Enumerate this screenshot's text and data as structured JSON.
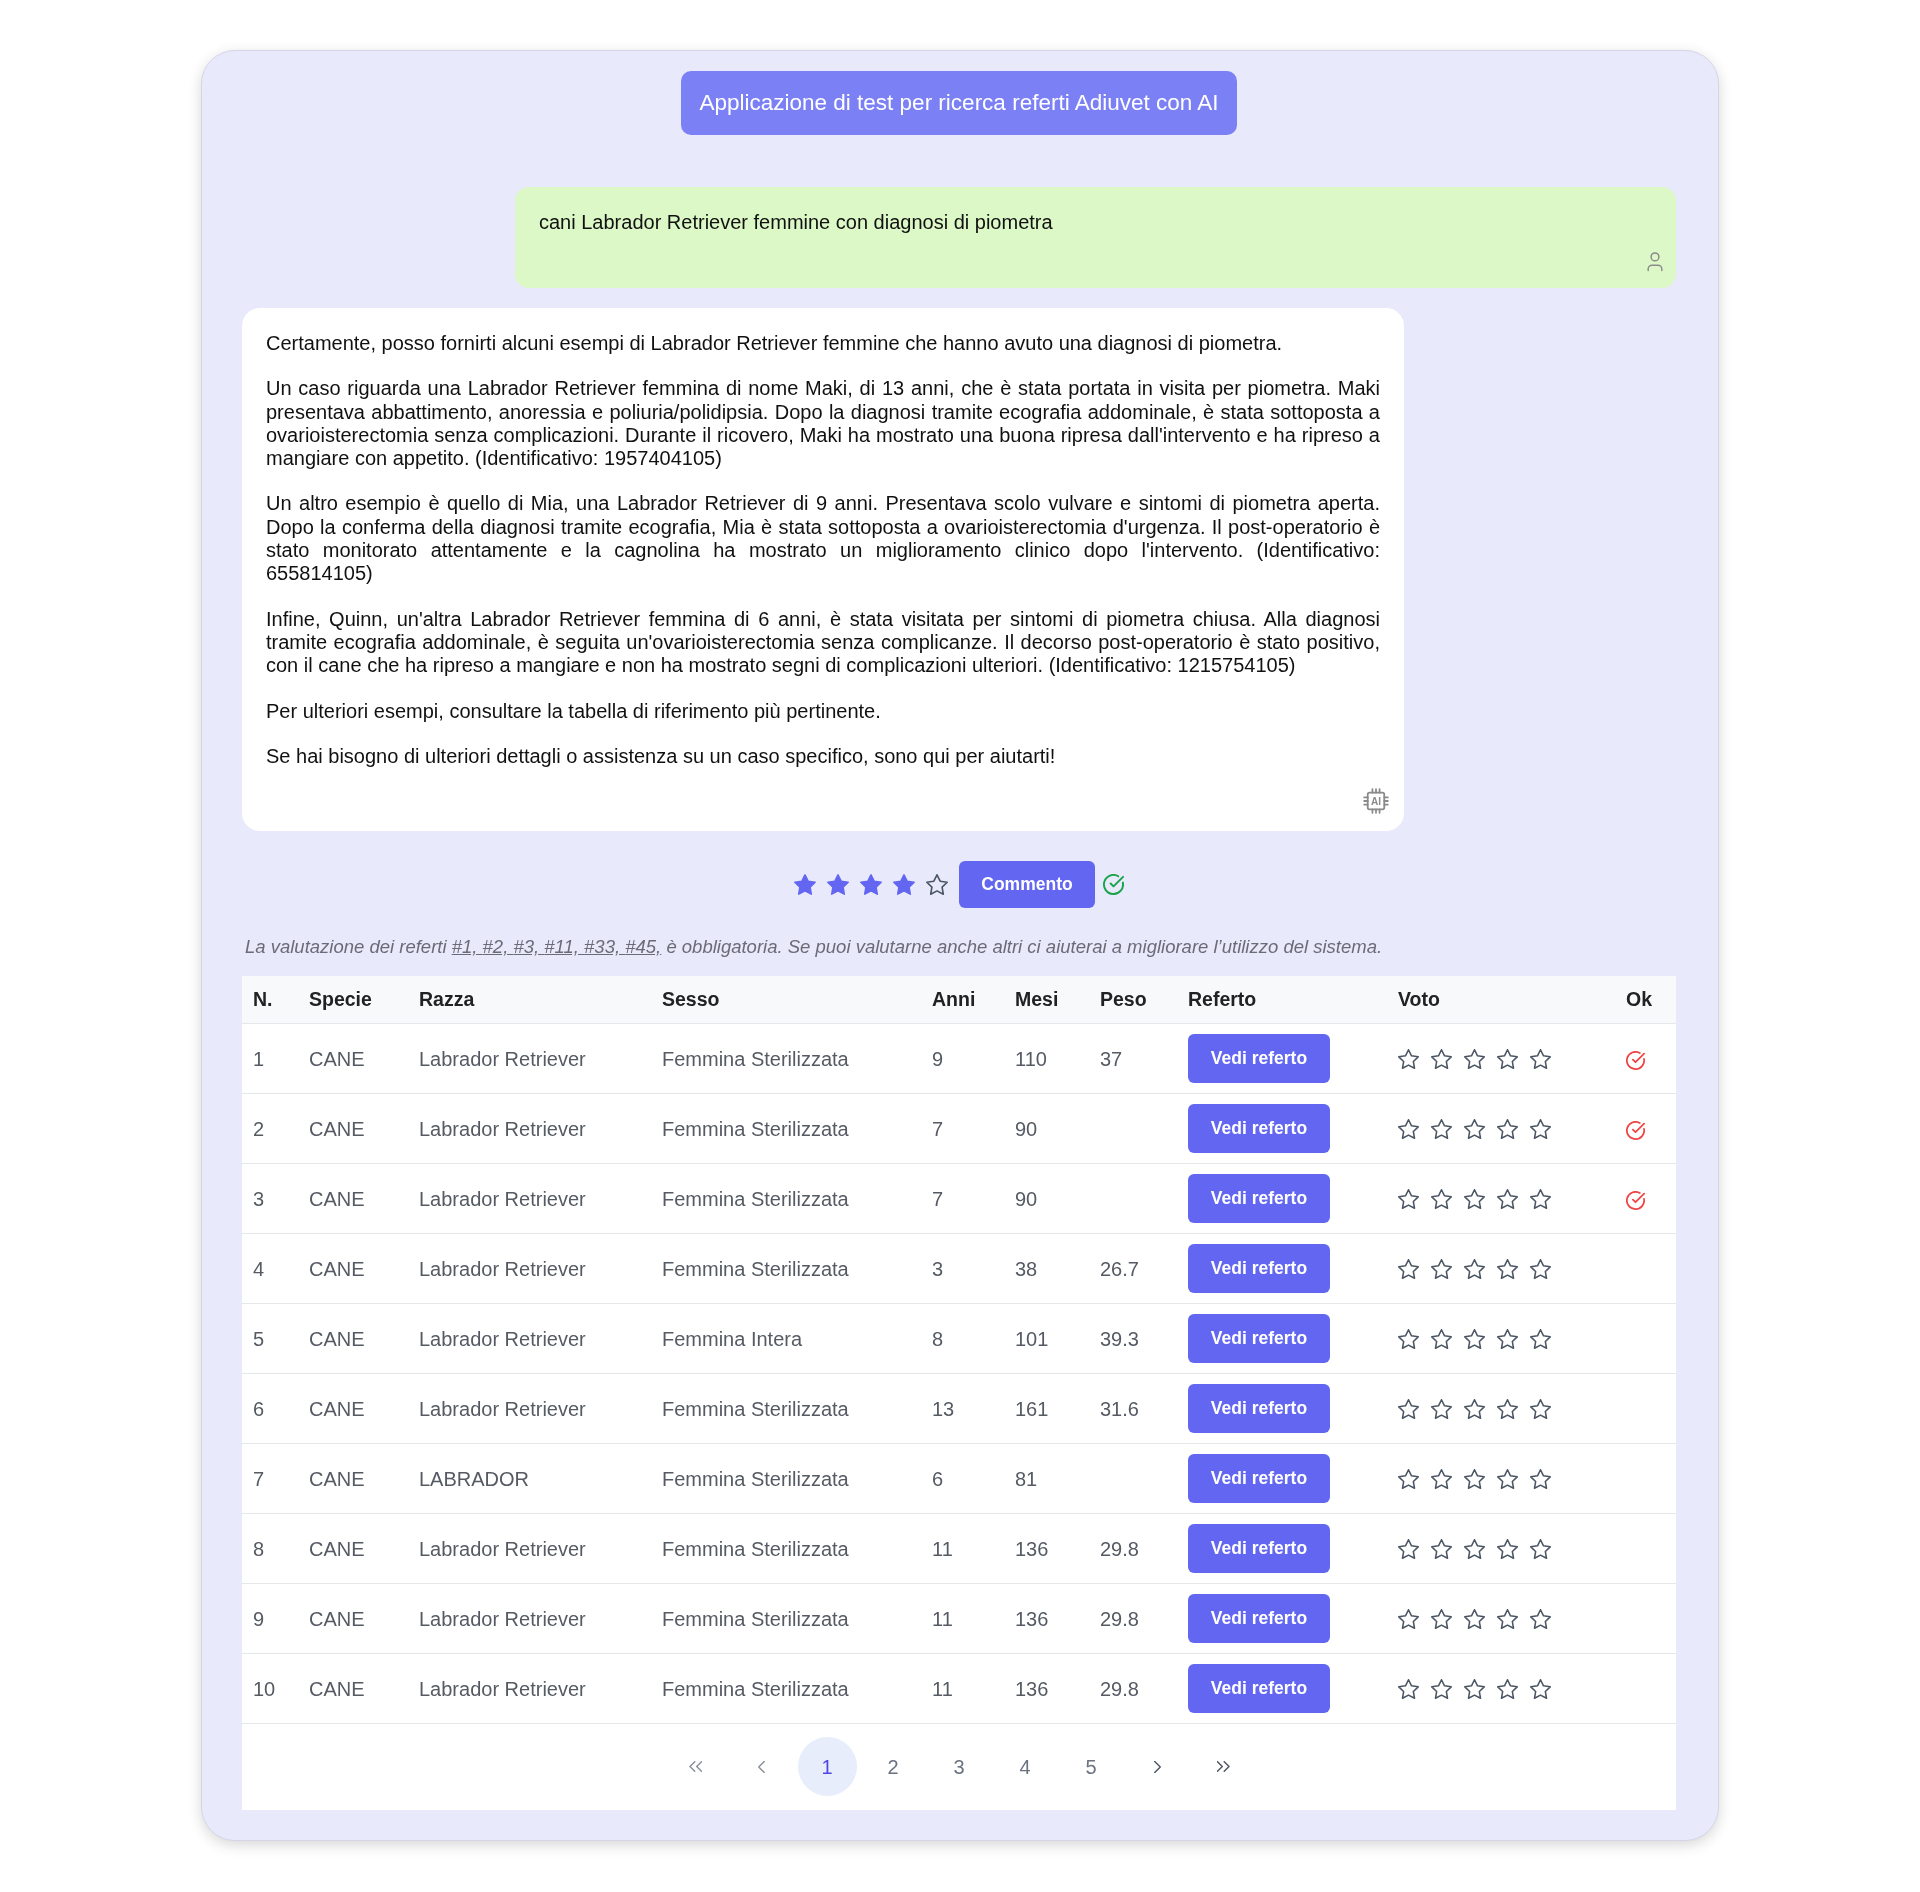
{
  "header": {
    "title": "Applicazione di test per ricerca referti Adiuvet con AI"
  },
  "conversation": [
    {
      "kind": "user",
      "text": "cani Labrador Retriever femmine con diagnosi di piometra"
    },
    {
      "kind": "assistant",
      "icon_label": "AI",
      "paragraphs": [
        "Certamente, posso fornirti alcuni esempi di Labrador Retriever femmine che hanno avuto una diagnosi di piometra.",
        "Un caso riguarda una Labrador Retriever femmina di nome Maki, di 13 anni, che è stata portata in visita per piometra. Maki presentava abbattimento, anoressia e poliuria/polidipsia. Dopo la diagnosi tramite ecografia addominale, è stata sottoposta a ovarioisterectomia senza complicazioni. Durante il ricovero, Maki ha mostrato una buona ripresa dall'intervento e ha ripreso a mangiare con appetito. (Identificativo: 1957404105)",
        "Un altro esempio è quello di Mia, una Labrador Retriever di 9 anni. Presentava scolo vulvare e sintomi di piometra aperta. Dopo la conferma della diagnosi tramite ecografia, Mia è stata sottoposta a ovarioisterectomia d'urgenza. Il post-operatorio è stato monitorato attentamente e la cagnolina ha mostrato un miglioramento clinico dopo l'intervento. (Identificativo: 655814105)",
        "Infine, Quinn, un'altra Labrador Retriever femmina di 6 anni, è stata visitata per sintomi di piometra chiusa. Alla diagnosi tramite ecografia addominale, è seguita un'ovarioisterectomia senza complicanze. Il decorso post-operatorio è stato positivo, con il cane che ha ripreso a mangiare e non ha mostrato segni di complicazioni ulteriori. (Identificativo: 1215754105)",
        "Per ulteriori esempi, consultare la tabella di riferimento più pertinente.",
        "Se hai bisogno di ulteriori dettagli o assistenza su un caso specifico, sono qui per aiutarti!"
      ]
    }
  ],
  "rating": {
    "stars": 4,
    "button": "Commento",
    "confirmed": true
  },
  "note": {
    "prefix": "La valutazione dei referti ",
    "links": [
      "#1, ",
      "#2, ",
      "#3, ",
      "#11, ",
      "#33, ",
      "#45,"
    ],
    "suffix": " è obbligatoria. Se puoi valutarne anche altri ci aiuterai a migliorare l’utilizzo del sistema."
  },
  "table": {
    "columns": [
      "N.",
      "Specie",
      "Razza",
      "Sesso",
      "Anni",
      "Mesi",
      "Peso",
      "Referto",
      "Voto",
      "Ok"
    ],
    "rows": [
      {
        "cells": [
          "1",
          "CANE",
          "Labrador Retriever",
          "Femmina Sterilizzata",
          "9",
          "110",
          "37"
        ],
        "button": "Vedi referto",
        "stars": 0,
        "checked": true
      },
      {
        "cells": [
          "2",
          "CANE",
          "Labrador Retriever",
          "Femmina Sterilizzata",
          "7",
          "90",
          null
        ],
        "button": "Vedi referto",
        "stars": 0,
        "checked": true
      },
      {
        "cells": [
          "3",
          "CANE",
          "Labrador Retriever",
          "Femmina Sterilizzata",
          "7",
          "90",
          null
        ],
        "button": "Vedi referto",
        "stars": 0,
        "checked": true
      },
      {
        "cells": [
          "4",
          "CANE",
          "Labrador Retriever",
          "Femmina Sterilizzata",
          "3",
          "38",
          "26.7"
        ],
        "button": "Vedi referto",
        "stars": 0,
        "checked": false
      },
      {
        "cells": [
          "5",
          "CANE",
          "Labrador Retriever",
          "Femmina Intera",
          "8",
          "101",
          "39.3"
        ],
        "button": "Vedi referto",
        "stars": 0,
        "checked": false
      },
      {
        "cells": [
          "6",
          "CANE",
          "Labrador Retriever",
          "Femmina Sterilizzata",
          "13",
          "161",
          "31.6"
        ],
        "button": "Vedi referto",
        "stars": 0,
        "checked": false
      },
      {
        "cells": [
          "7",
          "CANE",
          "LABRADOR",
          "Femmina Sterilizzata",
          "6",
          "81",
          null
        ],
        "button": "Vedi referto",
        "stars": 0,
        "checked": false
      },
      {
        "cells": [
          "8",
          "CANE",
          "Labrador Retriever",
          "Femmina Sterilizzata",
          "11",
          "136",
          "29.8"
        ],
        "button": "Vedi referto",
        "stars": 0,
        "checked": false
      },
      {
        "cells": [
          "9",
          "CANE",
          "Labrador Retriever",
          "Femmina Sterilizzata",
          "11",
          "136",
          "29.8"
        ],
        "button": "Vedi referto",
        "stars": 0,
        "checked": false
      },
      {
        "cells": [
          "10",
          "CANE",
          "Labrador Retriever",
          "Femmina Sterilizzata",
          "11",
          "136",
          "29.8"
        ],
        "button": "Vedi referto",
        "stars": 0,
        "checked": false
      }
    ]
  },
  "pagination": {
    "items": [
      {
        "kind": "first"
      },
      {
        "kind": "previous"
      },
      {
        "kind": "page",
        "label": "1",
        "selected": true
      },
      {
        "kind": "page",
        "label": "2",
        "selected": false
      },
      {
        "kind": "page",
        "label": "3",
        "selected": false
      },
      {
        "kind": "page",
        "label": "4",
        "selected": false
      },
      {
        "kind": "page",
        "label": "5",
        "selected": false
      },
      {
        "kind": "next"
      },
      {
        "kind": "last"
      }
    ]
  }
}
